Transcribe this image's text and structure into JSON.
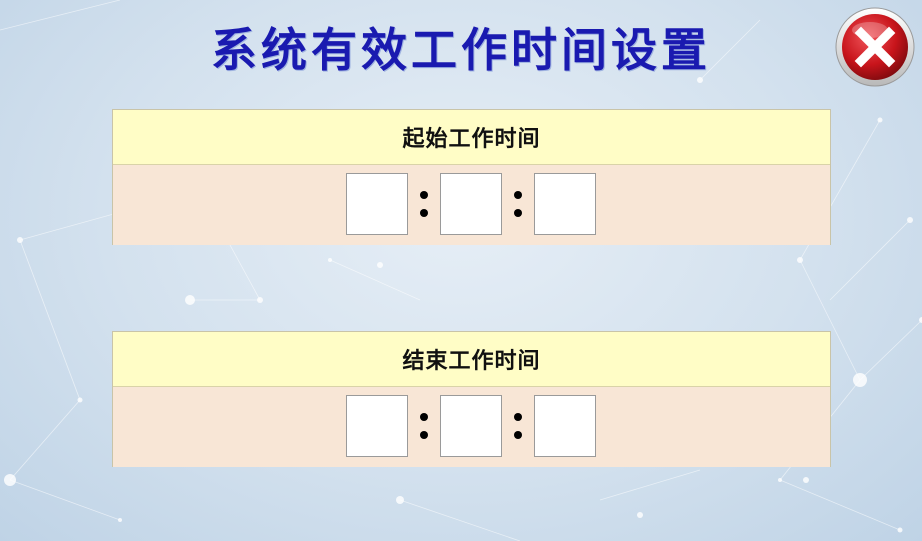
{
  "page": {
    "title": "系统有效工作时间设置"
  },
  "close_button": {
    "icon": "close-icon",
    "colors": {
      "circle": "#c8141b",
      "ring": "#e8e8e8",
      "cross": "#ffffff"
    }
  },
  "start_time": {
    "label": "起始工作时间",
    "hour": "",
    "minute": "",
    "second": ""
  },
  "end_time": {
    "label": "结束工作时间",
    "hour": "",
    "minute": "",
    "second": ""
  },
  "colors": {
    "title": "#1a1ab0",
    "panel_header_bg": "#fffdc6",
    "panel_body_bg": "#f8e6d6"
  }
}
